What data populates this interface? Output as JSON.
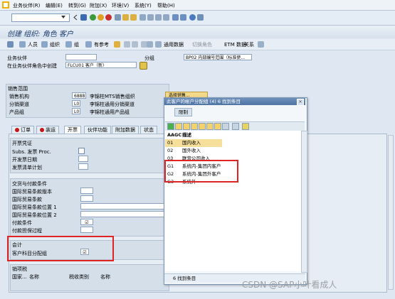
{
  "menu": [
    "业务伙伴(R)",
    "编辑(E)",
    "转到(G)",
    "附加(X)",
    "环境(V)",
    "系统(Y)",
    "帮助(H)"
  ],
  "page_title": "创建 组织: 角色 客户",
  "toolbar": {
    "person": "人员",
    "org": "组织",
    "group": "组",
    "ref": "有参考",
    "general_data": "通用数据",
    "role_switch": "切换角色",
    "etm": "ETM 数据",
    "relations": "关系"
  },
  "header": {
    "bp_label": "业务伙伴",
    "group_label": "分组",
    "group_value": "BP02 内部编号范围（标准使...",
    "create_in_role_label": "在业务伙伴角色中创建",
    "role_value": "FLCU01 客户（新）"
  },
  "sales_area": {
    "title": "销售范围",
    "rows": [
      {
        "label": "销售机构",
        "code": "6888",
        "desc": "李锦柱MTS销售组织"
      },
      {
        "label": "分销渠道",
        "code": "L0",
        "desc": "李锦柱通用分销渠道"
      },
      {
        "label": "产品组",
        "code": "L0",
        "desc": "李锦柱通用产品组"
      }
    ],
    "button": "选择销售..."
  },
  "tabs": [
    "订单",
    "装运",
    "开票",
    "伙伴功能",
    "附加数据",
    "状态"
  ],
  "billing": {
    "doc_title": "开票凭证",
    "subs_fix": "Subs. 发票 Proc.",
    "billing_dates": "开发票日期",
    "invoice_list": "发票清单计划",
    "delivery_title": "交货与付款条件",
    "incoterms_ver": "国际贸易条款版本",
    "incoterms": "国际贸易条款",
    "incoterms_loc1": "国际贸易条款位置 1",
    "incoterms_loc2": "国际贸易条款位置 2",
    "payment_terms": "付款条件",
    "credit_process": "付款担保过程",
    "accounting_title": "会计",
    "acct_assign_group": "客户科目分配组",
    "acct_assign_value": "☑",
    "tax_title": "销项税",
    "tax_cols": [
      "国家...",
      "名称",
      "税收类别",
      "名称"
    ]
  },
  "popup": {
    "title": "此客户的帐户分配组 (4)   6 找到条目",
    "restrict_tab": "限制",
    "col_code": "AAGC",
    "col_desc": "描述",
    "rows": [
      {
        "code": "01",
        "desc": "国内收入"
      },
      {
        "code": "02",
        "desc": "国外收入"
      },
      {
        "code": "03",
        "desc": "联营公司收入"
      },
      {
        "code": "G1",
        "desc": "系统内-集团内客户"
      },
      {
        "code": "G2",
        "desc": "系统内-集团外客户"
      },
      {
        "code": "G3",
        "desc": "系统外"
      }
    ],
    "footer": "6 找到条目"
  },
  "watermark": "CSDN @SAP小叶看成人"
}
